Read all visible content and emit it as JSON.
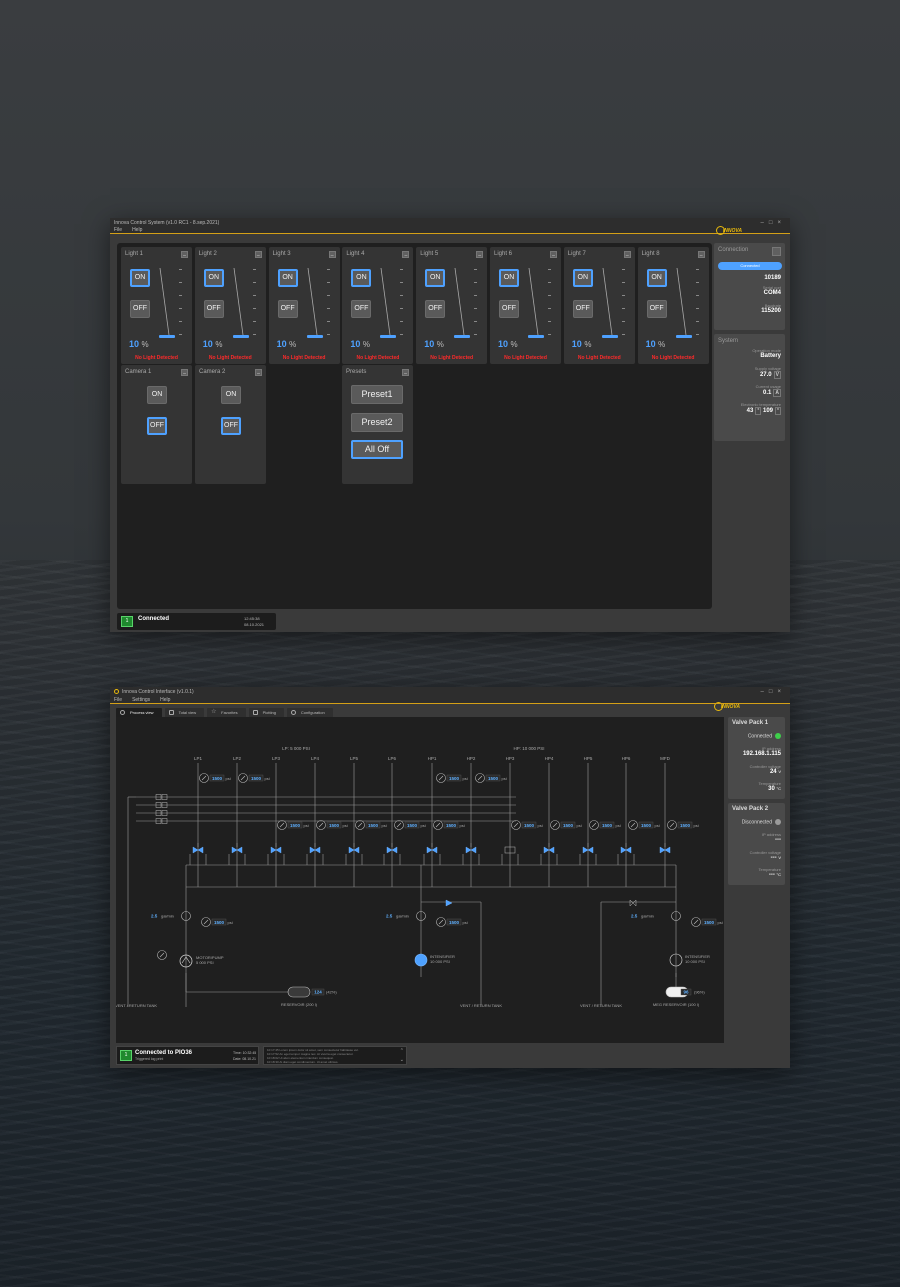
{
  "app1": {
    "title": "Innova Control System (v1.0 RC1 - 8.sep.2021)",
    "menu": [
      "File",
      "Help"
    ],
    "logo": "INNOVA",
    "lights": [
      {
        "label": "Light 1",
        "on": "ON",
        "off": "OFF",
        "value": "10",
        "unit": "%",
        "status": "No Light Detected"
      },
      {
        "label": "Light 2",
        "on": "ON",
        "off": "OFF",
        "value": "10",
        "unit": "%",
        "status": "No Light Detected"
      },
      {
        "label": "Light 3",
        "on": "ON",
        "off": "OFF",
        "value": "10",
        "unit": "%",
        "status": "No Light Detected"
      },
      {
        "label": "Light 4",
        "on": "ON",
        "off": "OFF",
        "value": "10",
        "unit": "%",
        "status": "No Light Detected"
      },
      {
        "label": "Light 5",
        "on": "ON",
        "off": "OFF",
        "value": "10",
        "unit": "%",
        "status": "No Light Detected"
      },
      {
        "label": "Light 6",
        "on": "ON",
        "off": "OFF",
        "value": "10",
        "unit": "%",
        "status": "No Light Detected"
      },
      {
        "label": "Light 7",
        "on": "ON",
        "off": "OFF",
        "value": "10",
        "unit": "%",
        "status": "No Light Detected"
      },
      {
        "label": "Light 8",
        "on": "ON",
        "off": "OFF",
        "value": "10",
        "unit": "%",
        "status": "No Light Detected"
      }
    ],
    "cameras": [
      {
        "label": "Camera 1",
        "on": "ON",
        "off": "OFF"
      },
      {
        "label": "Camera 2",
        "on": "ON",
        "off": "OFF"
      }
    ],
    "presets": {
      "label": "Presets",
      "buttons": [
        "Preset1",
        "Preset2",
        "All Off"
      ]
    },
    "connection": {
      "title": "Connection",
      "button": "Connected",
      "value1": "10189",
      "port_label": "Serial port",
      "port": "COM4",
      "baud_label": "Baudrate",
      "baud": "115200"
    },
    "system": {
      "title": "System",
      "mode_label": "Operation mode",
      "mode": "Battery",
      "voltage_label": "Supply voltage",
      "voltage": "27.0",
      "voltage_unit": "V",
      "current_label": "Current usage",
      "current": "0.1",
      "current_unit": "A",
      "temp_label": "Electronic temperature",
      "temp1": "43",
      "temp2": "109"
    },
    "status": {
      "icon": "1",
      "text": "Connected",
      "time": "12:45:38",
      "date": "08.10.2021"
    }
  },
  "app2": {
    "title": "Innova Control Interface (v1.0.1)",
    "menu": [
      "File",
      "Settings",
      "Help"
    ],
    "logo": "INNOVA",
    "tabs": [
      "Process view",
      "Total view",
      "Favorites",
      "Plotting",
      "Configuration"
    ],
    "diagram": {
      "lp_header": "LP: 5 000 PSI",
      "hp_header": "HP: 10 000 PSI",
      "channels": [
        "LP1",
        "LP2",
        "LP3",
        "LP4",
        "LP5",
        "LP6",
        "HP1",
        "HP2",
        "HP3",
        "HP4",
        "HP5",
        "HP6",
        "MFD"
      ],
      "psi_top": [
        "1500",
        "1500",
        "1500",
        "1500"
      ],
      "psi_mid": [
        "1500",
        "1500",
        "1500",
        "1500",
        "1500",
        "1500",
        "1500",
        "1500",
        "1500",
        "1500"
      ],
      "psi_unit": "psi",
      "flow_left": "2.5",
      "flow_mid": "2.5",
      "flow_right": "2.5",
      "flow_unit": "gal/min",
      "psi_pump_left": "1500",
      "psi_pump_mid": "1500",
      "psi_pump_right": "1500",
      "motor_label": "MOTOR/PUMP",
      "motor_sub": "5 000 PSI",
      "int1_label": "INTENSIFIER",
      "int1_sub": "10 000 PSI",
      "int2_label": "INTENSIFIER",
      "int2_sub": "10 000 PSI",
      "res1_value": "124",
      "res1_pct": "(42%)",
      "res1_label": "RESERVOIR (200 l)",
      "res2_value": "96",
      "res2_pct": "(96%)",
      "res2_label": "MEG RESERVOIR (100 l)",
      "vent1": "VENT / RETURN TANK",
      "vent2": "VENT / RETURN TANK",
      "vent3": "VENT / RETURN TANK"
    },
    "valve_packs": [
      {
        "title": "Valve Pack 1",
        "state": "Connected",
        "state_color": "#3ecf4a",
        "ip_label": "IP address",
        "ip": "192.168.1.115",
        "volt_label": "Controller voltage",
        "volt": "24",
        "volt_unit": "V",
        "temp_label": "Temperature",
        "temp": "30",
        "temp_unit": "°C"
      },
      {
        "title": "Valve Pack 2",
        "state": "Disconnected",
        "state_color": "#9a9a9a",
        "ip_label": "IP address",
        "ip": "---",
        "volt_label": "Controller voltage",
        "volt": "---",
        "volt_unit": "V",
        "temp_label": "Temperature",
        "temp": "---",
        "temp_unit": "°C"
      }
    ],
    "status": {
      "icon": "1",
      "text": "Connected to PIO36",
      "sub": "Triggered log print",
      "time_label": "Time: 10:32:45",
      "date_label": "Date: 08.10.21"
    },
    "log": [
      "10:17:45 Lorem ipsum dolor sit amet, sem consectetur habitasse vel.",
      "10:17:52 An eget tempor magna nec. At viverra eget consectetur.",
      "10:18:02 Ut alum elementum interdum consequat.",
      "10:18:30 At diam eget condimentum. Ut amet ultrices."
    ]
  }
}
